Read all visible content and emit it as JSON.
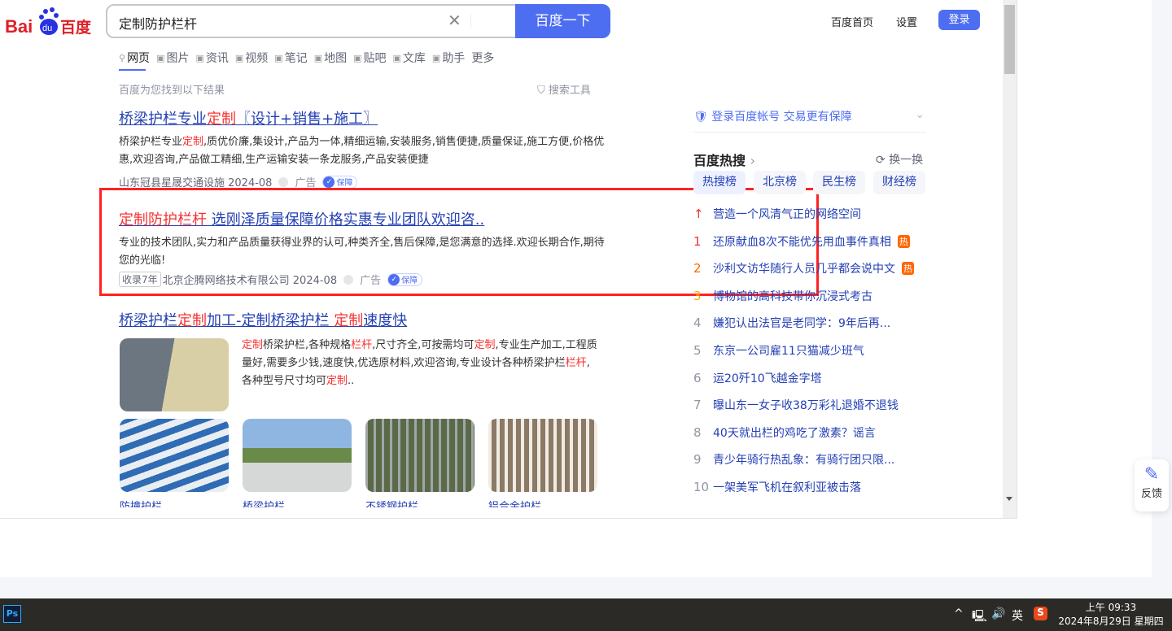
{
  "header": {
    "logo": "Bai度百度",
    "query": "定制防护栏杆",
    "search_button": "百度一下",
    "home_link": "百度首页",
    "settings_link": "设置",
    "login_button": "登录"
  },
  "tabs": [
    {
      "label": "网页",
      "icon": "search-icon"
    },
    {
      "label": "图片",
      "icon": "image-icon"
    },
    {
      "label": "资讯",
      "icon": "news-icon"
    },
    {
      "label": "视频",
      "icon": "video-icon"
    },
    {
      "label": "笔记",
      "icon": "note-icon"
    },
    {
      "label": "地图",
      "icon": "map-icon"
    },
    {
      "label": "贴吧",
      "icon": "tieba-icon"
    },
    {
      "label": "文库",
      "icon": "doc-icon"
    },
    {
      "label": "助手",
      "icon": "ai-icon"
    },
    {
      "label": "更多",
      "icon": ""
    }
  ],
  "result_hint": "百度为您找到以下结果",
  "search_tools": "搜索工具",
  "results": [
    {
      "title": [
        [
          "桥梁护栏专业",
          0
        ],
        [
          "定制",
          1
        ],
        [
          "〖设计+销售+施工〗",
          0
        ]
      ],
      "abstract": [
        [
          "桥梁护栏专业",
          0
        ],
        [
          "定制",
          1
        ],
        [
          ",质优价廉,集设计,产品为一体,精细运输,安装服务,销售便捷,质量保证,施工方便,价格优惠,欢迎咨询,产品做工精细,生产运输安装一条龙服务,产品安装便捷",
          0
        ]
      ],
      "source": "山东冠县星晟交通设施 2024-08",
      "ad": "广告",
      "badge": "保障"
    },
    {
      "title": [
        [
          "定制防护栏杆",
          1
        ],
        [
          " 选刚泽质量保障价格实惠专业团队欢迎咨..",
          0
        ]
      ],
      "abstract": [
        [
          "专业的技术团队,实力和产品质量获得业界的认可,种类齐全,售后保障,是您满意的选择.欢迎长期合作,期待您的光临!",
          0
        ]
      ],
      "years": "收录7年",
      "source": "北京企腾网络技术有限公司 2024-08",
      "ad": "广告",
      "badge": "保障"
    },
    {
      "title": [
        [
          "桥梁护栏",
          0
        ],
        [
          "定制",
          1
        ],
        [
          "加工-定制桥梁护栏 ",
          0
        ],
        [
          "定制",
          1
        ],
        [
          "速度快",
          0
        ]
      ],
      "abstract": [
        [
          "定制",
          1
        ],
        [
          "桥梁护栏,各种规格",
          0
        ],
        [
          "栏杆",
          1
        ],
        [
          ",尺寸齐全,可按需均可",
          0
        ],
        [
          "定制",
          1
        ],
        [
          ",专业生产加工,工程质量好,需要多少钱,速度快,优选原材料,欢迎咨询,专业设计各种桥梁护栏",
          0
        ],
        [
          "栏杆",
          1
        ],
        [
          ",各种型号尺寸均可",
          0
        ],
        [
          "定制",
          1
        ],
        [
          "..",
          0
        ]
      ],
      "captions": [
        "防撞护栏",
        "桥梁护栏",
        "不锈钢护栏",
        "铝合金护栏"
      ]
    }
  ],
  "sidebar": {
    "login_prompt": "登录百度帐号 交易更有保障",
    "hot_title": "百度热搜",
    "refresh": "换一换",
    "hot_tabs": [
      "热搜榜",
      "北京榜",
      "民生榜",
      "财经榜"
    ],
    "hot_items": [
      {
        "rank": "↑",
        "text": "营造一个风清气正的网络空间"
      },
      {
        "rank": "1",
        "text": "还原献血8次不能优先用血事件真相",
        "badge": "热"
      },
      {
        "rank": "2",
        "text": "沙利文访华随行人员几乎都会说中文",
        "badge": "热"
      },
      {
        "rank": "3",
        "text": "博物馆的高科技带你沉浸式考古"
      },
      {
        "rank": "4",
        "text": "嫌犯认出法官是老同学：9年后再..."
      },
      {
        "rank": "5",
        "text": "东京一公司雇11只猫减少班气"
      },
      {
        "rank": "6",
        "text": "运20歼10飞越金字塔"
      },
      {
        "rank": "7",
        "text": "曝山东一女子收38万彩礼退婚不退钱"
      },
      {
        "rank": "8",
        "text": "40天就出栏的鸡吃了激素？谣言"
      },
      {
        "rank": "9",
        "text": "青少年骑行热乱象：有骑行团只限..."
      },
      {
        "rank": "10",
        "text": "一架美军飞机在叙利亚被击落"
      }
    ],
    "rank_colors": [
      "#f73131",
      "#f73131",
      "#ff6600",
      "#faa90e"
    ]
  },
  "feedback": "反馈",
  "taskbar": {
    "ps": "Ps",
    "ime": "英",
    "time": "上午 09:33",
    "date": "2024年8月29日 星期四"
  }
}
